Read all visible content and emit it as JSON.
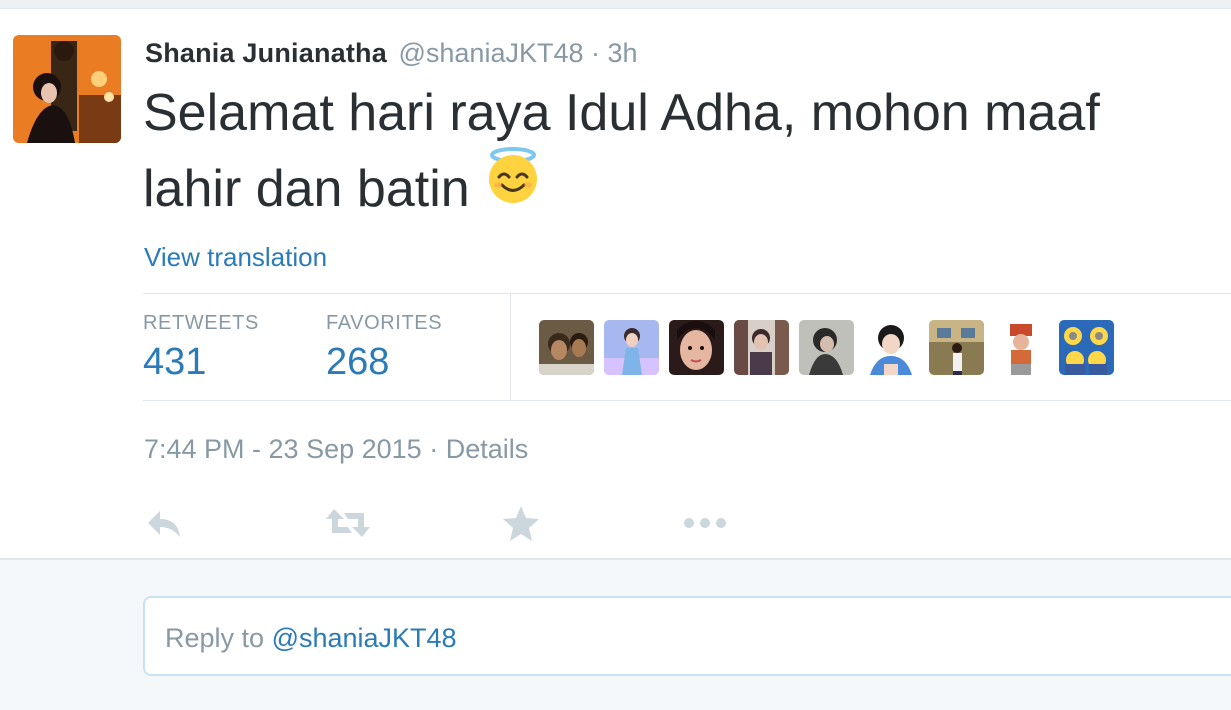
{
  "tweet": {
    "author": {
      "full_name": "Shania Junianatha",
      "screen_name": "@shaniaJKT48",
      "separator": "·",
      "age": "3h",
      "avatar_icon": "profile-photo"
    },
    "text_line1": "Selamat hari raya Idul Adha, mohon maaf",
    "text_line2": "lahir dan batin",
    "emoji": "smiling-face-with-halo",
    "view_translation": "View translation",
    "stats": {
      "retweets_label": "RETWEETS",
      "retweets_count": "431",
      "favorites_label": "FAVORITES",
      "favorites_count": "268"
    },
    "favorited_by": [
      {
        "name": "user-1"
      },
      {
        "name": "user-2"
      },
      {
        "name": "user-3"
      },
      {
        "name": "user-4"
      },
      {
        "name": "user-5"
      },
      {
        "name": "user-6"
      },
      {
        "name": "user-7"
      },
      {
        "name": "user-8"
      },
      {
        "name": "user-9"
      }
    ],
    "timestamp": "7:44 PM - 23 Sep 2015",
    "details_separator": "·",
    "details_link": "Details",
    "actions": [
      "reply-icon",
      "retweet-icon",
      "favorite-star-icon",
      "more-dots-icon"
    ]
  },
  "reply": {
    "prefix": "Reply to ",
    "mention": "@shaniaJKT48"
  },
  "colors": {
    "link_blue": "#2b7bb9",
    "muted_gray": "#8899a6",
    "text_dark": "#292f33",
    "action_gray": "#ccd6dd"
  }
}
